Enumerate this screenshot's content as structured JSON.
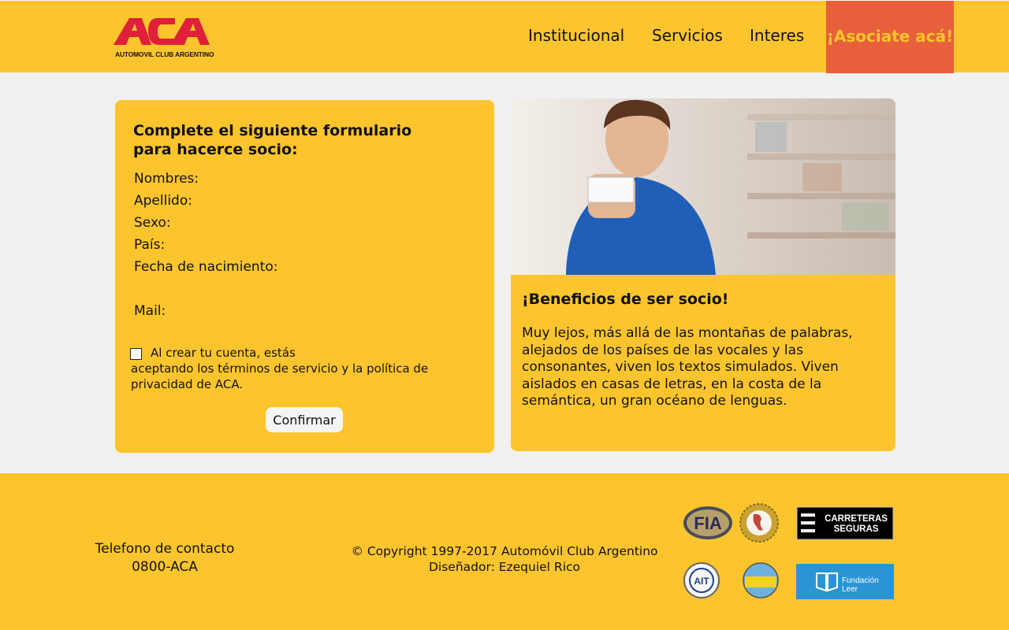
{
  "header": {
    "logo_text": "ACA",
    "logo_subtitle": "AUTOMOVIL CLUB ARGENTINO",
    "nav": [
      "Institucional",
      "Servicios",
      "Interes"
    ],
    "cta": "¡Asociate acá!"
  },
  "form": {
    "title": "Complete el siguiente formulario para hacerce socio:",
    "fields": [
      "Nombres:",
      "Apellido:",
      "Sexo:",
      "País:",
      "Fecha de nacimiento:",
      "Mail:"
    ],
    "terms_line1": "Al crear tu cuenta, estás",
    "terms_line2": "aceptando los términos de servicio y la política de privacidad de ACA.",
    "terms_checked": false,
    "confirm_label": "Confirmar"
  },
  "benefits": {
    "title": "¡Beneficios de ser socio!",
    "text": "Muy lejos, más allá de las montañas de palabras, alejados de los países de las vocales y las consonantes, viven los textos simulados. Viven aislados en casas de letras, en la costa de la semántica, un gran océano de lenguas."
  },
  "footer": {
    "contact_label": "Telefono de contacto",
    "contact_phone": "0800-ACA",
    "copyright": "© Copyright 1997-2017 Automóvil Club Argentino",
    "designer": "Diseñador: Ezequiel Rico",
    "partners": {
      "fia": "FIA",
      "carreteras_1": "CARRETERAS",
      "carreteras_2": "SEGURAS",
      "ait": "AIT",
      "fundacion_1": "Fundación",
      "fundacion_2": "Leer"
    }
  },
  "colors": {
    "brand_yellow": "#fdc52d",
    "accent_orange": "#e8603b",
    "logo_red": "#e0203a",
    "page_bg": "#f1f1f1"
  }
}
